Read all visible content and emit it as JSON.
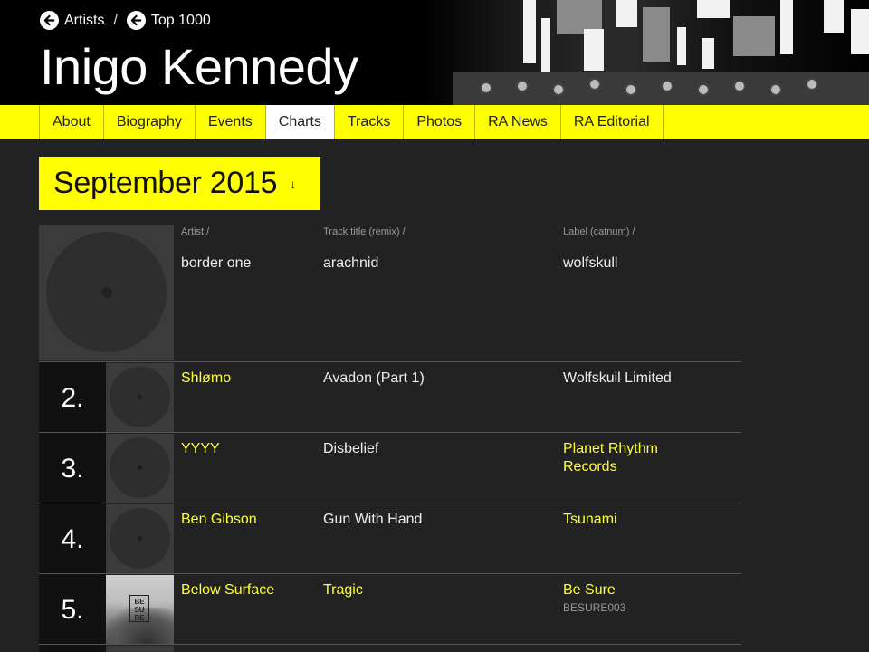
{
  "breadcrumbs": [
    {
      "label": "Artists"
    },
    {
      "label": "Top 1000"
    }
  ],
  "breadcrumb_separator": "/",
  "artist_name": "Inigo Kennedy",
  "nav": [
    {
      "label": "About",
      "active": false
    },
    {
      "label": "Biography",
      "active": false
    },
    {
      "label": "Events",
      "active": false
    },
    {
      "label": "Charts",
      "active": true
    },
    {
      "label": "Tracks",
      "active": false
    },
    {
      "label": "Photos",
      "active": false
    },
    {
      "label": "RA News",
      "active": false
    },
    {
      "label": "RA Editorial",
      "active": false
    }
  ],
  "month_selector": {
    "label": "September 2015",
    "arrow": "↓"
  },
  "columns": {
    "artist": "Artist /",
    "track": "Track title (remix) /",
    "label": "Label (catnum) /"
  },
  "first_entry": {
    "artist": "border one",
    "track": "arachnid",
    "label": "wolfskull"
  },
  "entries": [
    {
      "rank": "2.",
      "artist": "Shlømo",
      "track": "Avadon (Part 1)",
      "label": "Wolfskuil Limited",
      "catnum": ""
    },
    {
      "rank": "3.",
      "artist": "YYYY",
      "track": "Disbelief",
      "label": "Planet Rhythm Records",
      "catnum": ""
    },
    {
      "rank": "4.",
      "artist": "Ben Gibson",
      "track": "Gun With Hand",
      "label": "Tsunami",
      "catnum": ""
    },
    {
      "rank": "5.",
      "artist": "Below Surface",
      "track": "Tragic",
      "label": "Be Sure",
      "catnum": "BESURE003"
    }
  ],
  "cover_logo_text": "BE SU RE",
  "colors": {
    "accent": "#ffff00",
    "link": "#ffff33",
    "background": "#222222"
  }
}
